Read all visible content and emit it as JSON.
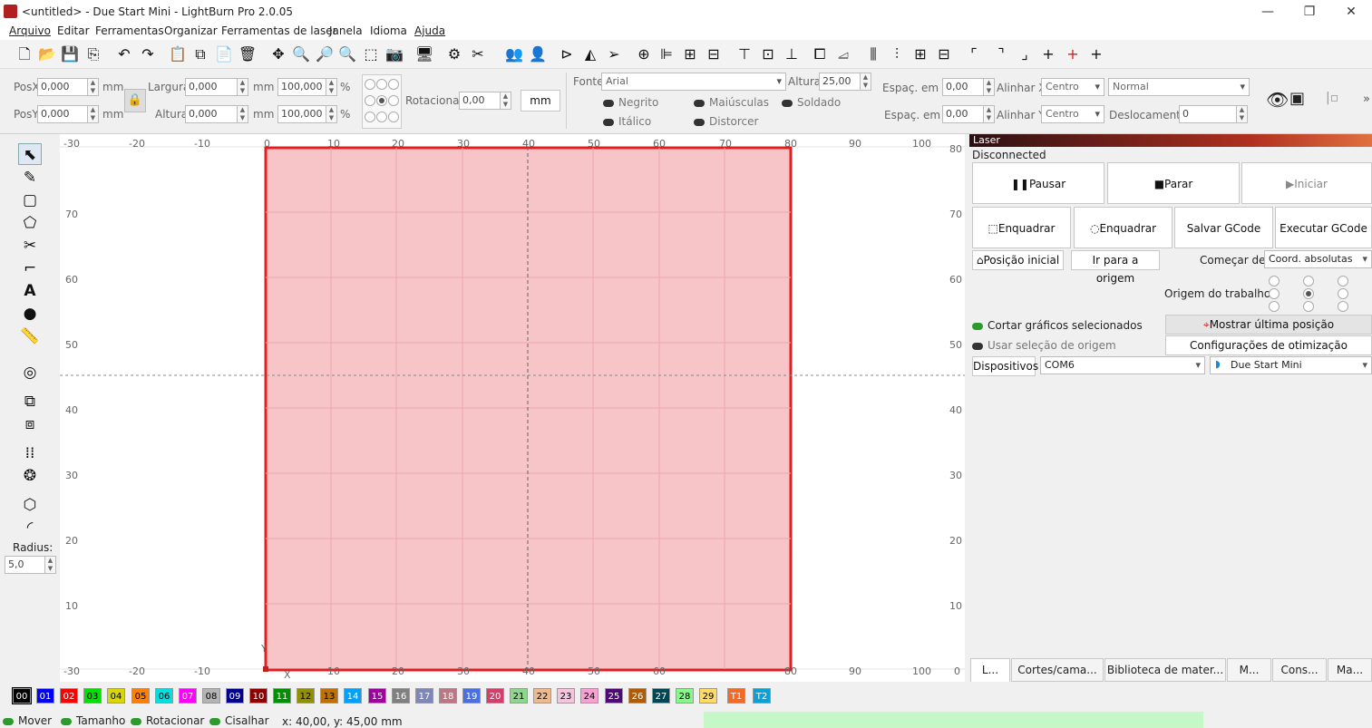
{
  "window": {
    "title": "<untitled> - Due Start Mini - LightBurn Pro 2.0.05",
    "minimize": "—",
    "maximize": "❐",
    "close": "✕"
  },
  "menu": [
    "Arquivo",
    "Editar",
    "Ferramentas",
    "Organizar",
    "Ferramentas de laser",
    "Janela",
    "Idioma",
    "Ajuda"
  ],
  "toolbar_icons": [
    "new-file-icon",
    "open-folder-icon",
    "save-icon",
    "save-as-icon",
    "undo-icon",
    "redo-icon",
    "paste-settings-icon",
    "copy-icon",
    "paste-icon",
    "delete-icon",
    "move-icon",
    "zoom-in-icon",
    "zoom-in-alt-icon",
    "zoom-out-icon",
    "frame-selection-icon",
    "camera-icon",
    "monitor-icon",
    "settings-icon",
    "tools-icon",
    "group-icon",
    "user-icon",
    "flip-icon",
    "mirror-icon",
    "send-icon",
    "target-icon",
    "align-left-icon",
    "align-center-icon",
    "align-right-icon",
    "align-top-icon",
    "align-middle-icon",
    "align-bottom-icon",
    "distribute-h-icon",
    "distribute-v-icon",
    "space-h-icon",
    "space-v-icon",
    "center-h-icon",
    "center-v-icon",
    "corner-icon",
    "corner-alt-icon",
    "arrange-icon",
    "cross-icon",
    "cross-red-icon",
    "cross-alt-icon"
  ],
  "props": {
    "posx_label": "PosX",
    "posx": "0,000",
    "posy_label": "PosY",
    "posy": "0,000",
    "unit": "mm",
    "width_label": "Largura",
    "width": "0,000",
    "height_label": "Altura",
    "height": "0,000",
    "scale_w": "100,000",
    "scale_h": "100,000",
    "pct": "%",
    "rotate_label": "Rotacionar",
    "rotate": "0,00",
    "mm_button": "mm",
    "font_label": "Fonte",
    "font": "Arial",
    "font_height_label": "Altura",
    "font_height": "25,00",
    "bold": "Negrito",
    "upper": "Maiúsculas",
    "welded": "Soldado",
    "italic": "Itálico",
    "distort": "Distorcer",
    "hspace_label": "Espaç. em H",
    "hspace": "0,00",
    "vspace_label": "Espaç. em V",
    "vspace": "0,00",
    "alignx_label": "Alinhar X",
    "alignx": "Centro",
    "aligny_label": "Alinhar Y",
    "aligny": "Centro",
    "mode": "Normal",
    "offset_label": "Deslocamento",
    "offset": "0"
  },
  "left_tools": {
    "radius_label": "Radius:",
    "radius": "5,0"
  },
  "ruler": {
    "top": [
      "-30",
      "-20",
      "-10",
      "0",
      "10",
      "20",
      "30",
      "40",
      "50",
      "60",
      "70",
      "80",
      "90",
      "100"
    ],
    "left": [
      "80",
      "70",
      "60",
      "50",
      "40",
      "30",
      "20",
      "10",
      "0"
    ],
    "bottom": [
      "-30",
      "-20",
      "-10",
      "0",
      "10",
      "20",
      "30",
      "40",
      "50",
      "60",
      "70",
      "80",
      "90",
      "100"
    ],
    "right": [
      "80",
      "70",
      "60",
      "50",
      "40",
      "30",
      "20",
      "10",
      "0"
    ],
    "axis_y": "Y",
    "axis_x": "X"
  },
  "laser": {
    "title": "Laser",
    "status": "Disconnected",
    "pause": "Pausar",
    "stop": "Parar",
    "start": "Iniciar",
    "frame1": "Enquadrar",
    "frame2": "Enquadrar",
    "save_gcode": "Salvar GCode",
    "run_gcode": "Executar GCode",
    "home": "Posição inicial",
    "go_origin": "Ir para a origem",
    "start_from_label": "Começar de:",
    "start_from": "Coord. absolutas",
    "job_origin_label": "Origem do trabalho",
    "cut_selected": "Cortar gráficos selecionados",
    "use_origin": "Usar seleção de origem",
    "show_last": "Mostrar última posição",
    "optim": "Configurações de otimização",
    "devices": "Dispositivos",
    "port": "COM6",
    "device": "Due Start Mini"
  },
  "tabs": [
    "L...",
    "Cortes/cama...",
    "Biblioteca de mater...",
    "M...",
    "Cons...",
    "Ma..."
  ],
  "palette": [
    {
      "t": "00",
      "c": "#000000",
      "f": "#ffffff"
    },
    {
      "t": "01",
      "c": "#0000ff",
      "f": "#ffffff"
    },
    {
      "t": "02",
      "c": "#ff0000",
      "f": "#ffffff"
    },
    {
      "t": "03",
      "c": "#00e000",
      "f": "#000000"
    },
    {
      "t": "04",
      "c": "#d8d800",
      "f": "#000000"
    },
    {
      "t": "05",
      "c": "#ff8000",
      "f": "#000000"
    },
    {
      "t": "06",
      "c": "#00e0e0",
      "f": "#000000"
    },
    {
      "t": "07",
      "c": "#ff00ff",
      "f": "#ffffff"
    },
    {
      "t": "08",
      "c": "#b4b4b4",
      "f": "#000000"
    },
    {
      "t": "09",
      "c": "#000090",
      "f": "#ffffff"
    },
    {
      "t": "10",
      "c": "#900000",
      "f": "#ffffff"
    },
    {
      "t": "11",
      "c": "#009000",
      "f": "#ffffff"
    },
    {
      "t": "12",
      "c": "#909000",
      "f": "#000000"
    },
    {
      "t": "13",
      "c": "#c07000",
      "f": "#000000"
    },
    {
      "t": "14",
      "c": "#00a0ff",
      "f": "#ffffff"
    },
    {
      "t": "15",
      "c": "#a000a0",
      "f": "#ffffff"
    },
    {
      "t": "16",
      "c": "#808080",
      "f": "#ffffff"
    },
    {
      "t": "17",
      "c": "#7d87b9",
      "f": "#ffffff"
    },
    {
      "t": "18",
      "c": "#bb7784",
      "f": "#ffffff"
    },
    {
      "t": "19",
      "c": "#4a6fe3",
      "f": "#ffffff"
    },
    {
      "t": "20",
      "c": "#d33f6a",
      "f": "#ffffff"
    },
    {
      "t": "21",
      "c": "#8cd78c",
      "f": "#000000"
    },
    {
      "t": "22",
      "c": "#f0b98d",
      "f": "#000000"
    },
    {
      "t": "23",
      "c": "#f6c4e1",
      "f": "#000000"
    },
    {
      "t": "24",
      "c": "#fa9ed4",
      "f": "#000000"
    },
    {
      "t": "25",
      "c": "#500a78",
      "f": "#ffffff"
    },
    {
      "t": "26",
      "c": "#b45a00",
      "f": "#ffffff"
    },
    {
      "t": "27",
      "c": "#004754",
      "f": "#ffffff"
    },
    {
      "t": "28",
      "c": "#86fa88",
      "f": "#000000"
    },
    {
      "t": "29",
      "c": "#ffdb66",
      "f": "#000000"
    },
    {
      "t": "T1",
      "c": "#f36926",
      "f": "#ffffff"
    },
    {
      "t": "T2",
      "c": "#0ca0d9",
      "f": "#ffffff"
    }
  ],
  "status": {
    "move": "Mover",
    "size": "Tamanho",
    "rotate": "Rotacionar",
    "shear": "Cisalhar",
    "coords": "x: 40,00, y: 45,00 mm"
  },
  "colors": {
    "accent": "#e02020",
    "fill": "#f7c5c8",
    "progress": "#c6f7c6"
  }
}
